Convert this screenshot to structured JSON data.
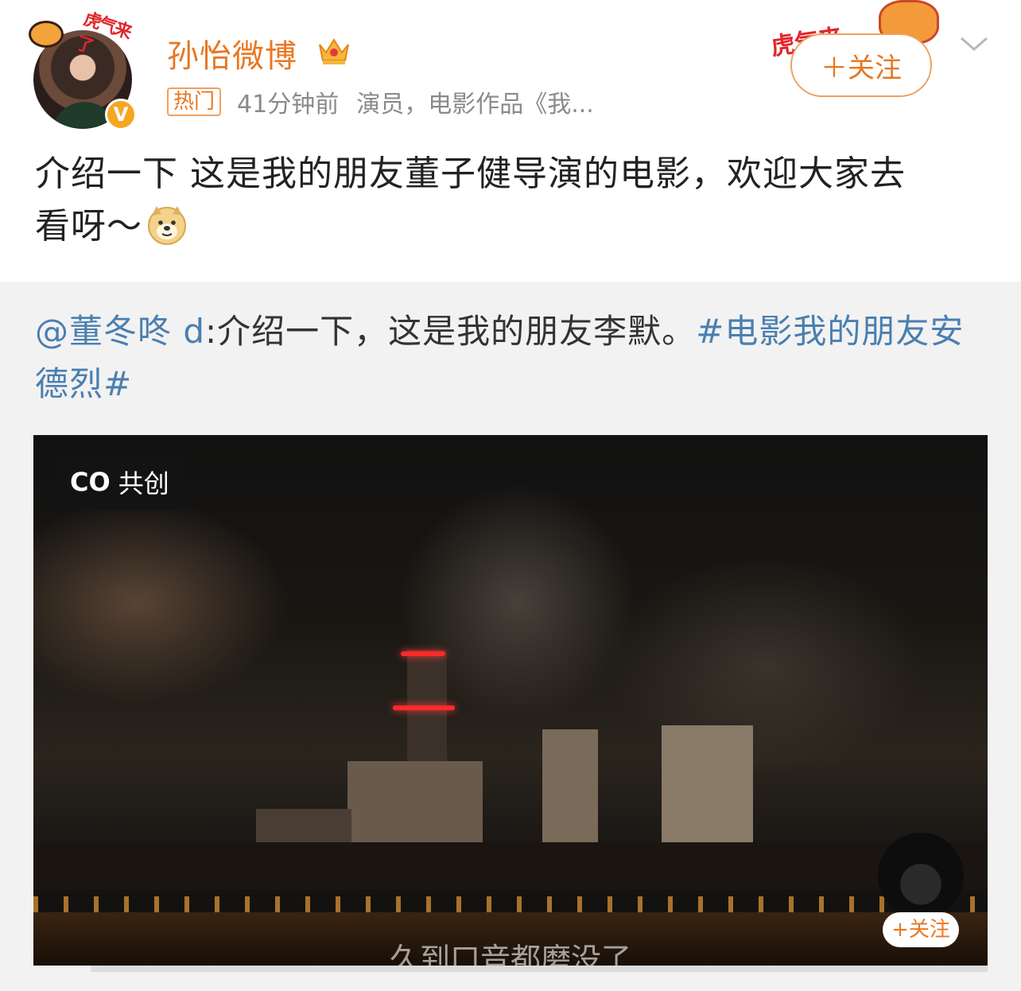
{
  "post": {
    "author": "孙怡微博",
    "hot_badge": "热门",
    "time": "41分钟前",
    "bio": "演员，电影作品《我...",
    "follow_label": "＋关注",
    "avatar_frame_text": "虎气来了",
    "follow_decor_text": "虎气来",
    "text_line1": "介绍一下 这是我的朋友董子健导演的电影，欢迎大家去",
    "text_line2": "看呀～",
    "emoji": "doge-emoji"
  },
  "repost": {
    "mention": "@董冬咚 d",
    "text": ":介绍一下，这是我的朋友李默。",
    "hashtag_part1": "#电影我的朋友安",
    "hashtag_part2": "德烈#"
  },
  "video": {
    "co_icon": "co-icon",
    "co_label": "共创",
    "subtitle": "久到口音都磨没了",
    "mini_follow_label": "+关注",
    "progress": 0.06
  },
  "colors": {
    "accent": "#e87722",
    "link": "#4a7fb0",
    "repost_bg": "#f2f2f2"
  }
}
